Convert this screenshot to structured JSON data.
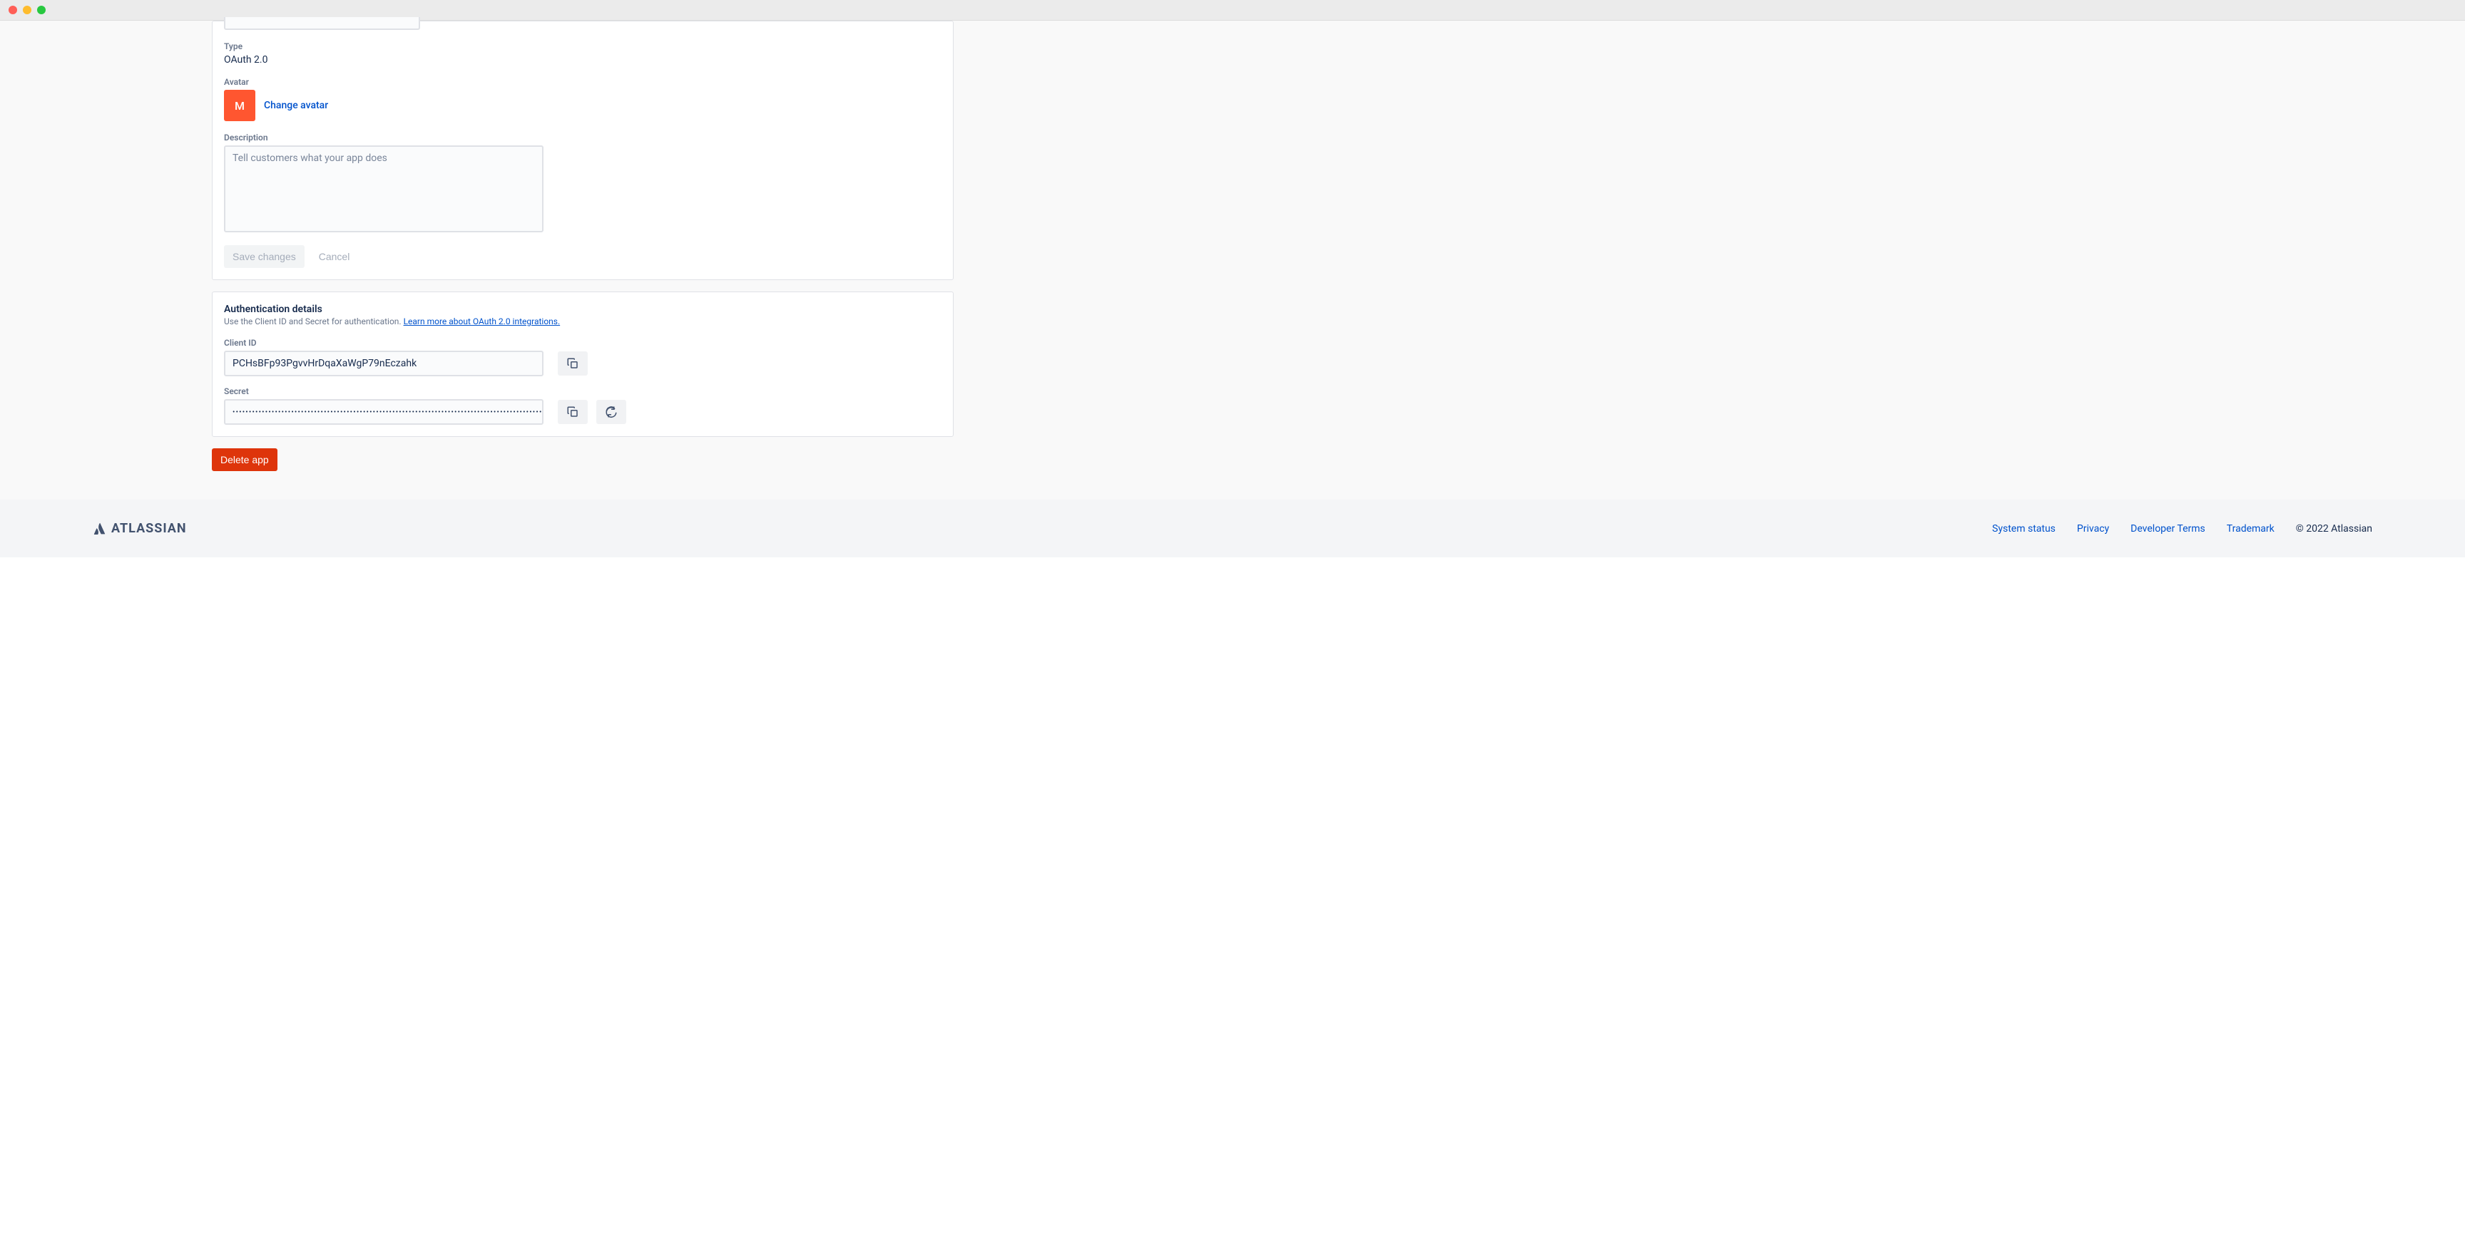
{
  "form": {
    "type_label": "Type",
    "type_value": "OAuth 2.0",
    "avatar_label": "Avatar",
    "avatar_letter": "M",
    "change_avatar": "Change avatar",
    "description_label": "Description",
    "description_placeholder": "Tell customers what your app does",
    "save_label": "Save changes",
    "cancel_label": "Cancel"
  },
  "auth": {
    "heading": "Authentication details",
    "sub_prefix": "Use the Client ID and Secret for authentication. ",
    "sub_link": "Learn more about OAuth 2.0 integrations.",
    "client_id_label": "Client ID",
    "client_id_value": "PCHsBFp93PgvvHrDqaXaWgP79nEczahk",
    "secret_label": "Secret",
    "secret_value": "••••••••••••••••••••••••••••••••••••••••••••••••••••••••••••••••••••••••••••••••••••••••••••••••••••••••••••••••••••••••••••••••"
  },
  "delete_label": "Delete app",
  "footer": {
    "brand": "ATLASSIAN",
    "links": [
      "System status",
      "Privacy",
      "Developer Terms",
      "Trademark"
    ],
    "copyright": "© 2022 Atlassian"
  }
}
